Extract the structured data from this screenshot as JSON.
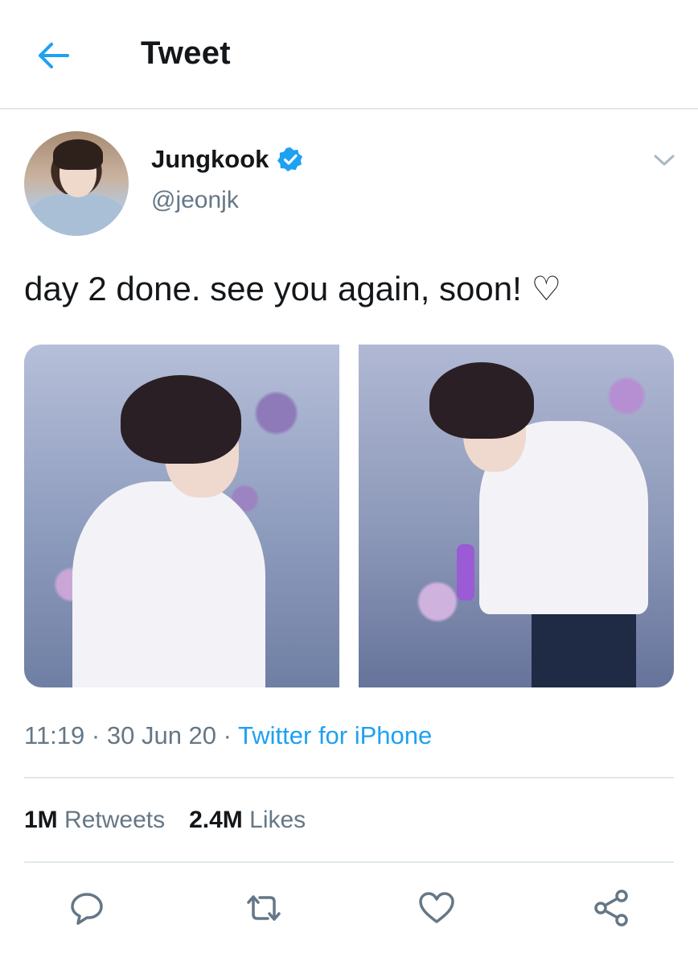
{
  "header": {
    "title": "Tweet",
    "back_icon": "arrow-left-icon",
    "accent": "#1da1f2"
  },
  "author": {
    "name": "Jungkook",
    "handle": "@jeonjk",
    "verified": true,
    "verified_icon": "verified-badge-icon",
    "menu_icon": "chevron-down-icon"
  },
  "tweet": {
    "text": "day 2 done. see you again, soon! ♡"
  },
  "media": {
    "photos": [
      {
        "name": "photo-1"
      },
      {
        "name": "photo-2"
      }
    ]
  },
  "meta": {
    "time": "11:19",
    "separator": "·",
    "date": "30 Jun 20",
    "source": "Twitter for iPhone"
  },
  "stats": {
    "retweets_count": "1M",
    "retweets_label": "Retweets",
    "likes_count": "2.4M",
    "likes_label": "Likes"
  },
  "actions": [
    {
      "icon": "reply-icon"
    },
    {
      "icon": "retweet-icon"
    },
    {
      "icon": "like-heart-icon"
    },
    {
      "icon": "share-icon"
    }
  ],
  "colors": {
    "text": "#14171a",
    "secondary": "#657786",
    "divider": "#e1e8ed",
    "link": "#1da1f2"
  }
}
